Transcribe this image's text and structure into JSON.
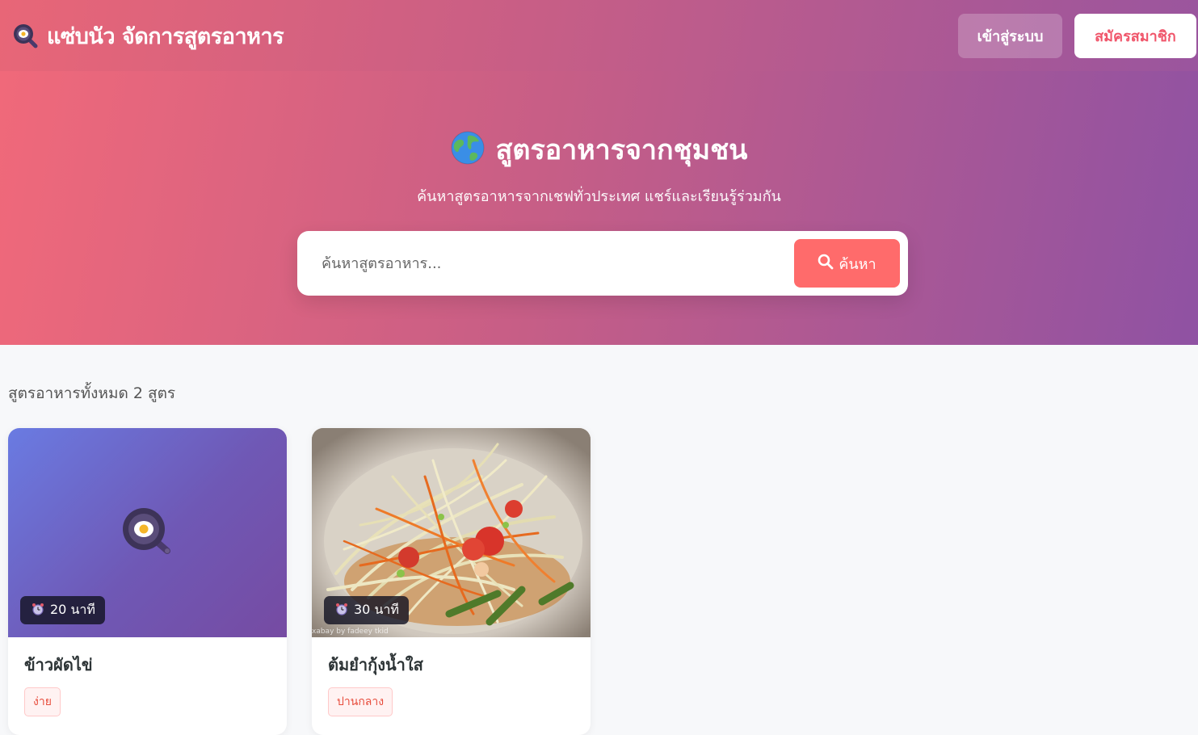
{
  "navbar": {
    "brand_icon": "frying-pan-icon",
    "brand_text": "แซ่บนัว จัดการสูตรอาหาร",
    "login_label": "เข้าสู่ระบบ",
    "register_label": "สมัครสมาชิก"
  },
  "hero": {
    "icon": "globe-icon",
    "title": "สูตรอาหารจากชุมชน",
    "subtitle": "ค้นหาสูตรอาหารจากเชฟทั่วประเทศ แชร์และเรียนรู้ร่วมกัน",
    "search_placeholder": "ค้นหาสูตรอาหาร...",
    "search_value": "",
    "search_button_label": "ค้นหา"
  },
  "results": {
    "count_text": "สูตรอาหารทั้งหมด 2 สูตร"
  },
  "recipes": [
    {
      "title": "ข้าวผัดไข่",
      "time": "20 นาที",
      "difficulty": "ง่าย",
      "image": "frying-pan-placeholder"
    },
    {
      "title": "ต้มยำกุ้งน้ำใส",
      "time": "30 นาที",
      "difficulty": "ปานกลาง",
      "image": "papaya-salad-photo",
      "image_caption": "xabay by fadeey tkid"
    }
  ],
  "colors": {
    "accent": "#ff6b6b",
    "header_gradient_start": "#e86677",
    "header_gradient_end": "#9a559e",
    "card_gradient_start": "#6a7be2",
    "card_gradient_end": "#764ba2"
  }
}
